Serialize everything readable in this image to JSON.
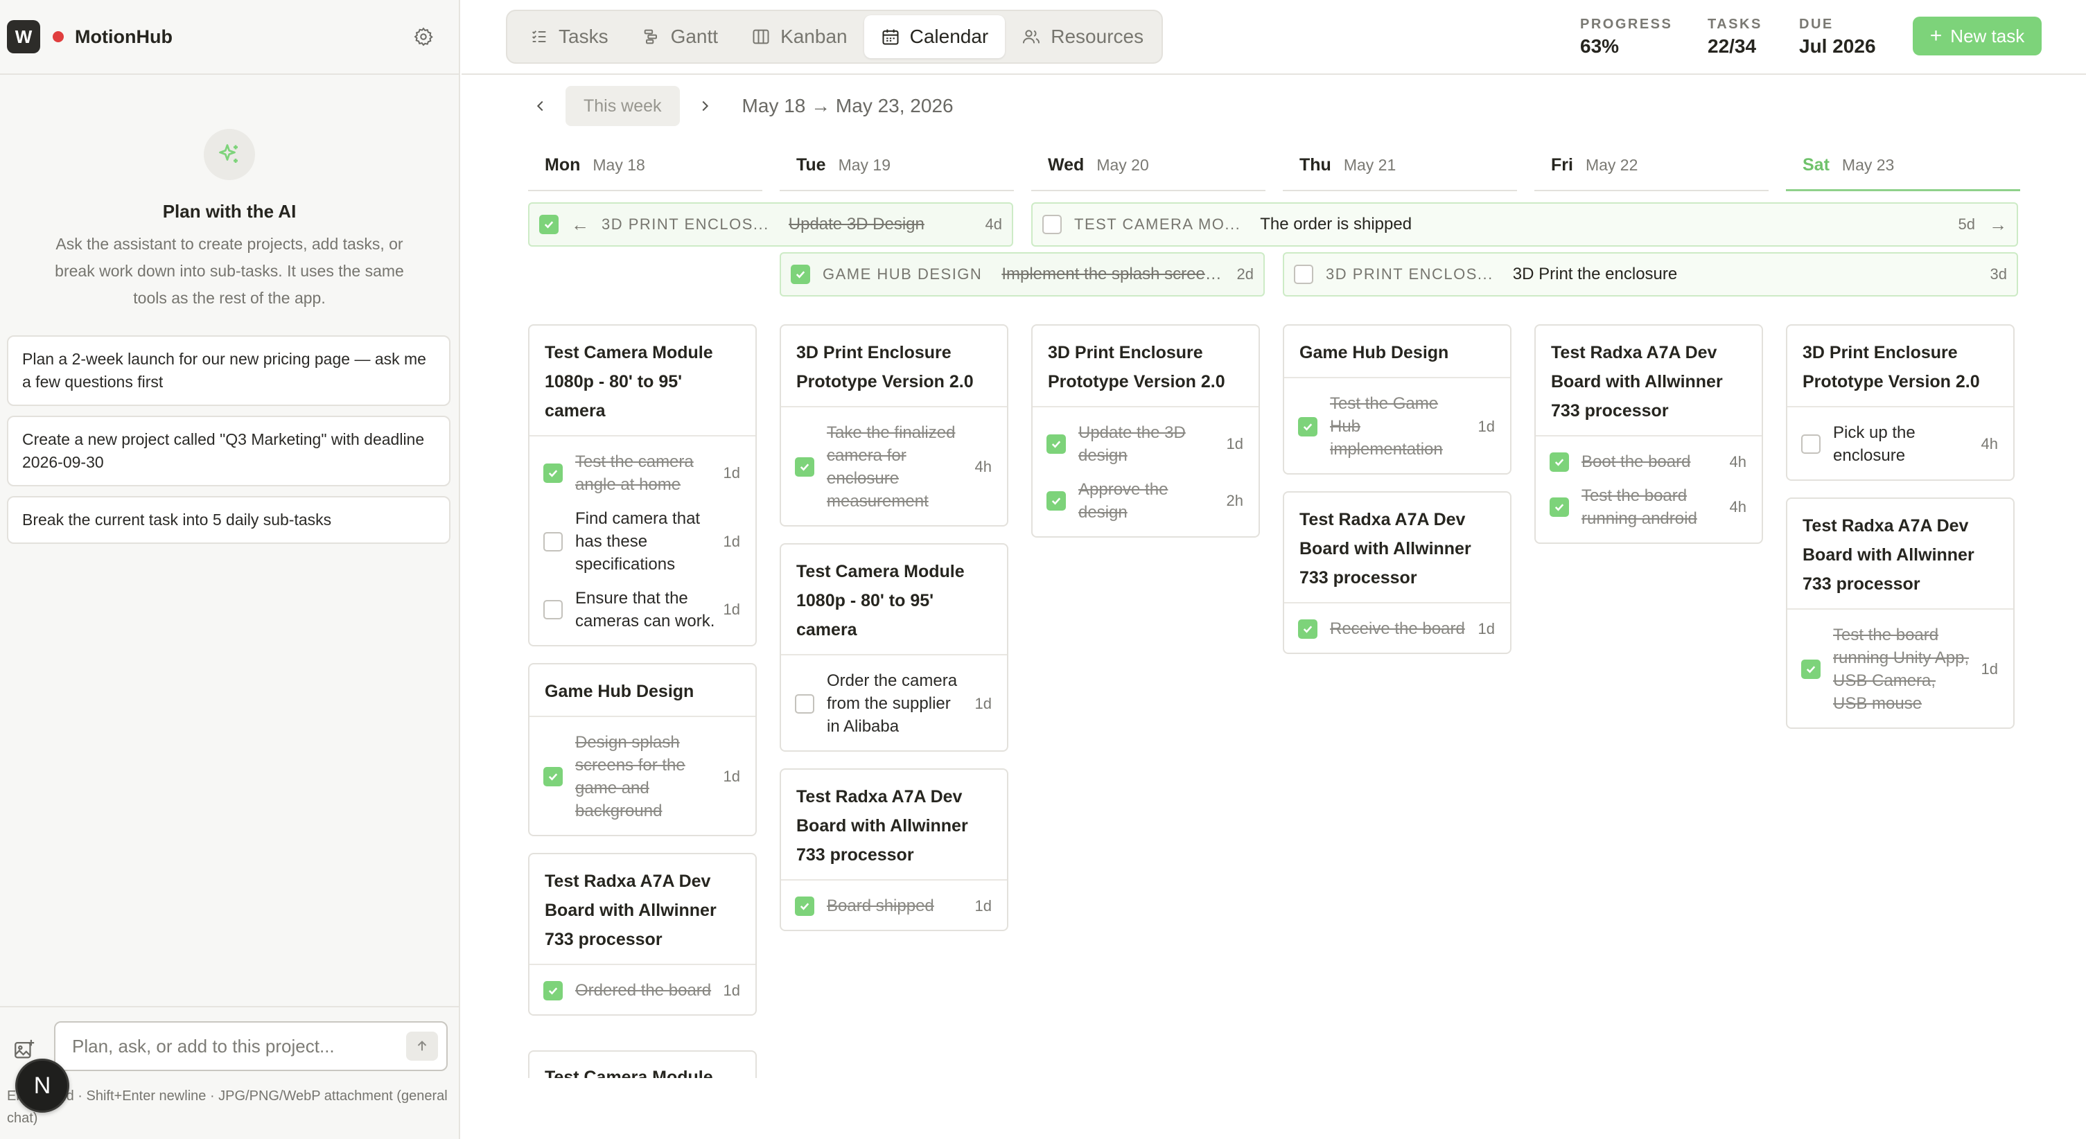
{
  "app": {
    "logo_letter": "W",
    "name": "MotionHub"
  },
  "sidebar": {
    "ai_title": "Plan with the AI",
    "ai_desc": "Ask the assistant to create projects, add tasks, or break work down into sub-tasks. It uses the same tools as the rest of the app.",
    "suggestions": [
      "Plan a 2-week launch for our new pricing page — ask me a few questions first",
      "Create a new project called \"Q3 Marketing\" with deadline 2026-09-30",
      "Break the current task into 5 daily sub-tasks"
    ],
    "input_placeholder": "Plan, ask, or add to this project...",
    "hint": "Enter send · Shift+Enter newline · JPG/PNG/WebP attachment (general chat)",
    "avatar_letter": "N"
  },
  "tabs": [
    {
      "label": "Tasks",
      "icon": "list-icon",
      "active": false
    },
    {
      "label": "Gantt",
      "icon": "gantt-icon",
      "active": false
    },
    {
      "label": "Kanban",
      "icon": "kanban-icon",
      "active": false
    },
    {
      "label": "Calendar",
      "icon": "calendar-icon",
      "active": true
    },
    {
      "label": "Resources",
      "icon": "people-icon",
      "active": false
    }
  ],
  "stats": {
    "progress": {
      "label": "PROGRESS",
      "value": "63%"
    },
    "tasks": {
      "label": "TASKS",
      "value": "22/34"
    },
    "due": {
      "label": "DUE",
      "value": "Jul 2026"
    }
  },
  "new_task_label": "New task",
  "week": {
    "this_week_label": "This week",
    "range": "May 18 → May 23, 2026"
  },
  "days": [
    {
      "name": "Mon",
      "date": "May 18",
      "today": false
    },
    {
      "name": "Tue",
      "date": "May 19",
      "today": false
    },
    {
      "name": "Wed",
      "date": "May 20",
      "today": false
    },
    {
      "name": "Thu",
      "date": "May 21",
      "today": false
    },
    {
      "name": "Fri",
      "date": "May 22",
      "today": false
    },
    {
      "name": "Sat",
      "date": "May 23",
      "today": true
    }
  ],
  "spans": [
    {
      "project": "3D PRINT ENCLOS...",
      "title": "Update 3D Design",
      "duration": "4d",
      "done": true,
      "arrow_left": true,
      "arrow_right": false
    },
    {
      "project": "TEST CAMERA MO...",
      "title": "The order is shipped",
      "duration": "5d",
      "done": false,
      "arrow_left": false,
      "arrow_right": true
    },
    {
      "project": "GAME HUB DESIGN",
      "title": "Implement the splash screen...",
      "duration": "2d",
      "done": true,
      "arrow_left": false,
      "arrow_right": false
    },
    {
      "project": "3D PRINT ENCLOS...",
      "title": "3D Print the enclosure",
      "duration": "3d",
      "done": false,
      "arrow_left": false,
      "arrow_right": false
    }
  ],
  "cards": [
    {
      "day": 0,
      "title": "Test Camera Module 1080p - 80' to 95' camera",
      "subs": [
        {
          "text": "Test the camera angle at home",
          "dur": "1d",
          "done": true
        },
        {
          "text": "Find camera that has these specifications",
          "dur": "1d",
          "done": false
        },
        {
          "text": "Ensure that the cameras can work.",
          "dur": "1d",
          "done": false
        }
      ]
    },
    {
      "day": 0,
      "title": "Game Hub Design",
      "subs": [
        {
          "text": "Design splash screens for the game and background",
          "dur": "1d",
          "done": true
        }
      ]
    },
    {
      "day": 0,
      "title": "Test Radxa A7A Dev Board with Allwinner 733 processor",
      "subs": [
        {
          "text": "Ordered the board",
          "dur": "1d",
          "done": true
        }
      ]
    },
    {
      "day": 1,
      "title": "3D Print Enclosure Prototype Version 2.0",
      "subs": [
        {
          "text": "Take the finalized camera for enclosure measurement",
          "dur": "4h",
          "done": true
        }
      ]
    },
    {
      "day": 1,
      "title": "Test Camera Module 1080p - 80' to 95' camera",
      "subs": [
        {
          "text": "Order the camera from the supplier in Alibaba",
          "dur": "1d",
          "done": false
        }
      ]
    },
    {
      "day": 1,
      "title": "Test Radxa A7A Dev Board with Allwinner 733 processor",
      "subs": [
        {
          "text": "Board shipped",
          "dur": "1d",
          "done": true
        }
      ]
    },
    {
      "day": 2,
      "title": "3D Print Enclosure Prototype Version 2.0",
      "subs": [
        {
          "text": "Update the 3D design",
          "dur": "1d",
          "done": true
        },
        {
          "text": "Approve the design",
          "dur": "2h",
          "done": true
        }
      ]
    },
    {
      "day": 3,
      "title": "Game Hub Design",
      "subs": [
        {
          "text": "Test the Game Hub implementation",
          "dur": "1d",
          "done": true
        }
      ]
    },
    {
      "day": 3,
      "title": "Test Radxa A7A Dev Board with Allwinner 733 processor",
      "subs": [
        {
          "text": "Receive the board",
          "dur": "1d",
          "done": true
        }
      ]
    },
    {
      "day": 4,
      "title": "Test Radxa A7A Dev Board with Allwinner 733 processor",
      "subs": [
        {
          "text": "Boot the board",
          "dur": "4h",
          "done": true
        },
        {
          "text": "Test the board running android",
          "dur": "4h",
          "done": true
        }
      ]
    },
    {
      "day": 5,
      "title": "3D Print Enclosure Prototype Version 2.0",
      "subs": [
        {
          "text": "Pick up the enclosure",
          "dur": "4h",
          "done": false
        }
      ]
    },
    {
      "day": 5,
      "title": "Test Radxa A7A Dev Board with Allwinner 733 processor",
      "subs": [
        {
          "text": "Test the board running Unity App, USB Camera, USB mouse",
          "dur": "1d",
          "done": true
        }
      ]
    }
  ],
  "clipped_card_title": "Test Camera Module"
}
